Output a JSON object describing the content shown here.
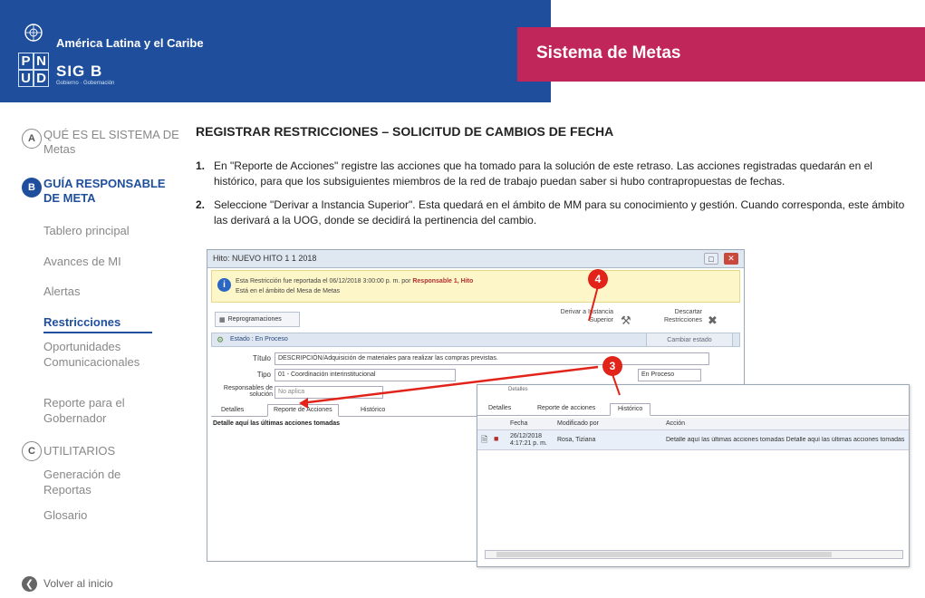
{
  "header": {
    "region": "América Latina y el Caribe",
    "logo_letters": [
      "P",
      "N",
      "U",
      "D"
    ],
    "brand": "SIG B",
    "brand_sub": "Gobierno · Gobernación",
    "system_title": "Sistema de Metas",
    "colors": {
      "blue": "#1f4f9c",
      "magenta": "#c0265a"
    }
  },
  "sidebar": {
    "sections": [
      {
        "letter": "A",
        "label": "QUÉ ES EL SISTEMA DE Metas"
      },
      {
        "letter": "B",
        "label": "GUÍA RESPONSABLE DE META"
      },
      {
        "letter": "C",
        "label": "UTILITARIOS"
      }
    ],
    "items_b": [
      "Tablero principal",
      "Avances de MI",
      "Alertas",
      "Restricciones",
      "Oportunidades Comunicacionales",
      "Reporte para el Gobernador"
    ],
    "active_item": "Restricciones",
    "items_c": [
      "Generación de Reportas",
      "Glosario"
    ],
    "back": "Volver al inicio"
  },
  "main": {
    "title": "REGISTRAR RESTRICCIONES – SOLICITUD DE CAMBIOS DE FECHA",
    "steps": [
      {
        "num": "1.",
        "text": "En \"Reporte de Acciones\" registre las acciones que ha tomado para la solución de este retraso. Las acciones registradas quedarán en el histórico, para que los subsiguientes miembros de la red de trabajo puedan saber si hubo contrapropuestas de fechas."
      },
      {
        "num": "2.",
        "text": "Seleccione \"Derivar a Instancia Superior\". Esta quedará en el ámbito de MM para su conocimiento y gestión. Cuando corresponda, este ámbito las derivará a la UOG, donde se decidirá la pertinencia del cambio."
      }
    ]
  },
  "window": {
    "title": "Hito: NUEVO HITO 1 1 2018",
    "notice": "Esta Restricción fue reportada el 06/12/2018 3:00:00 p. m. por",
    "notice_user": "Responsable 1, Hito",
    "notice_line2": "Está en el ámbito del Mesa de Metas",
    "reprogramaciones": "Reprogramaciones",
    "derivar": "Derivar a Instancia Superior",
    "descartar": "Descartar Restricciones",
    "estado_label": "Estado : En Proceso",
    "cambiar_estado": "Cambiar estado",
    "fields": {
      "titulo_label": "Título",
      "titulo_value": "DESCRIPCIÓN/Adquisición de materiales para realizar las compras previstas.",
      "tipo_label": "Tipo",
      "tipo_value": "01 - Coordinación interinstitucional",
      "estado_value": "En Proceso",
      "responsables_label": "Responsables de solución",
      "responsables_value": "No aplica"
    },
    "tabs": [
      "Detalles",
      "Reporte de Acciones",
      "Histórico"
    ],
    "detalle": "Detalle aquí las últimas acciones tomadas"
  },
  "popup": {
    "tab_top": "Detalles",
    "tabs": [
      "Detalles",
      "Reporte de acciones",
      "Histórico"
    ],
    "headers": [
      "Fecha",
      "Modificado por",
      "Acción"
    ],
    "row": {
      "date": "26/12/2018 4:17:21 p. m.",
      "user": "Rosa, Tiziana",
      "action": "Detalle aquí las últimas acciones tomadas Detalle aquí las últimas acciones tomadas"
    }
  },
  "callouts": [
    "4",
    "3"
  ]
}
